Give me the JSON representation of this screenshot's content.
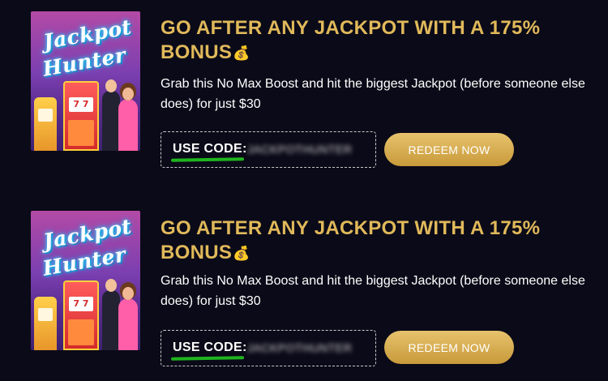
{
  "promos": [
    {
      "image_title_line1": "Jackpot",
      "image_title_line2": "Hunter",
      "image_slot_symbols": "7 7",
      "title": "GO AFTER ANY JACKPOT WITH A 175% BONUS",
      "title_emoji": "💰",
      "description": "Grab this No Max Boost and hit the biggest Jackpot (before someone else does) for just $30",
      "code_label": "USE CODE:",
      "code_value": "JACKPOTHUNTER",
      "redeem_label": "REDEEM NOW"
    },
    {
      "image_title_line1": "Jackpot",
      "image_title_line2": "Hunter",
      "image_slot_symbols": "7 7",
      "title": "GO AFTER ANY JACKPOT WITH A 175% BONUS",
      "title_emoji": "💰",
      "description": "Grab this No Max Boost and hit the biggest Jackpot (before someone else does) for just $30",
      "code_label": "USE CODE:",
      "code_value": "JACKPOTHUNTER",
      "redeem_label": "REDEEM NOW"
    }
  ],
  "colors": {
    "background": "#0b0a18",
    "title_gold": "#e0b95a",
    "button_gold": "#d4ab4f",
    "code_underline": "#1fb51f"
  }
}
